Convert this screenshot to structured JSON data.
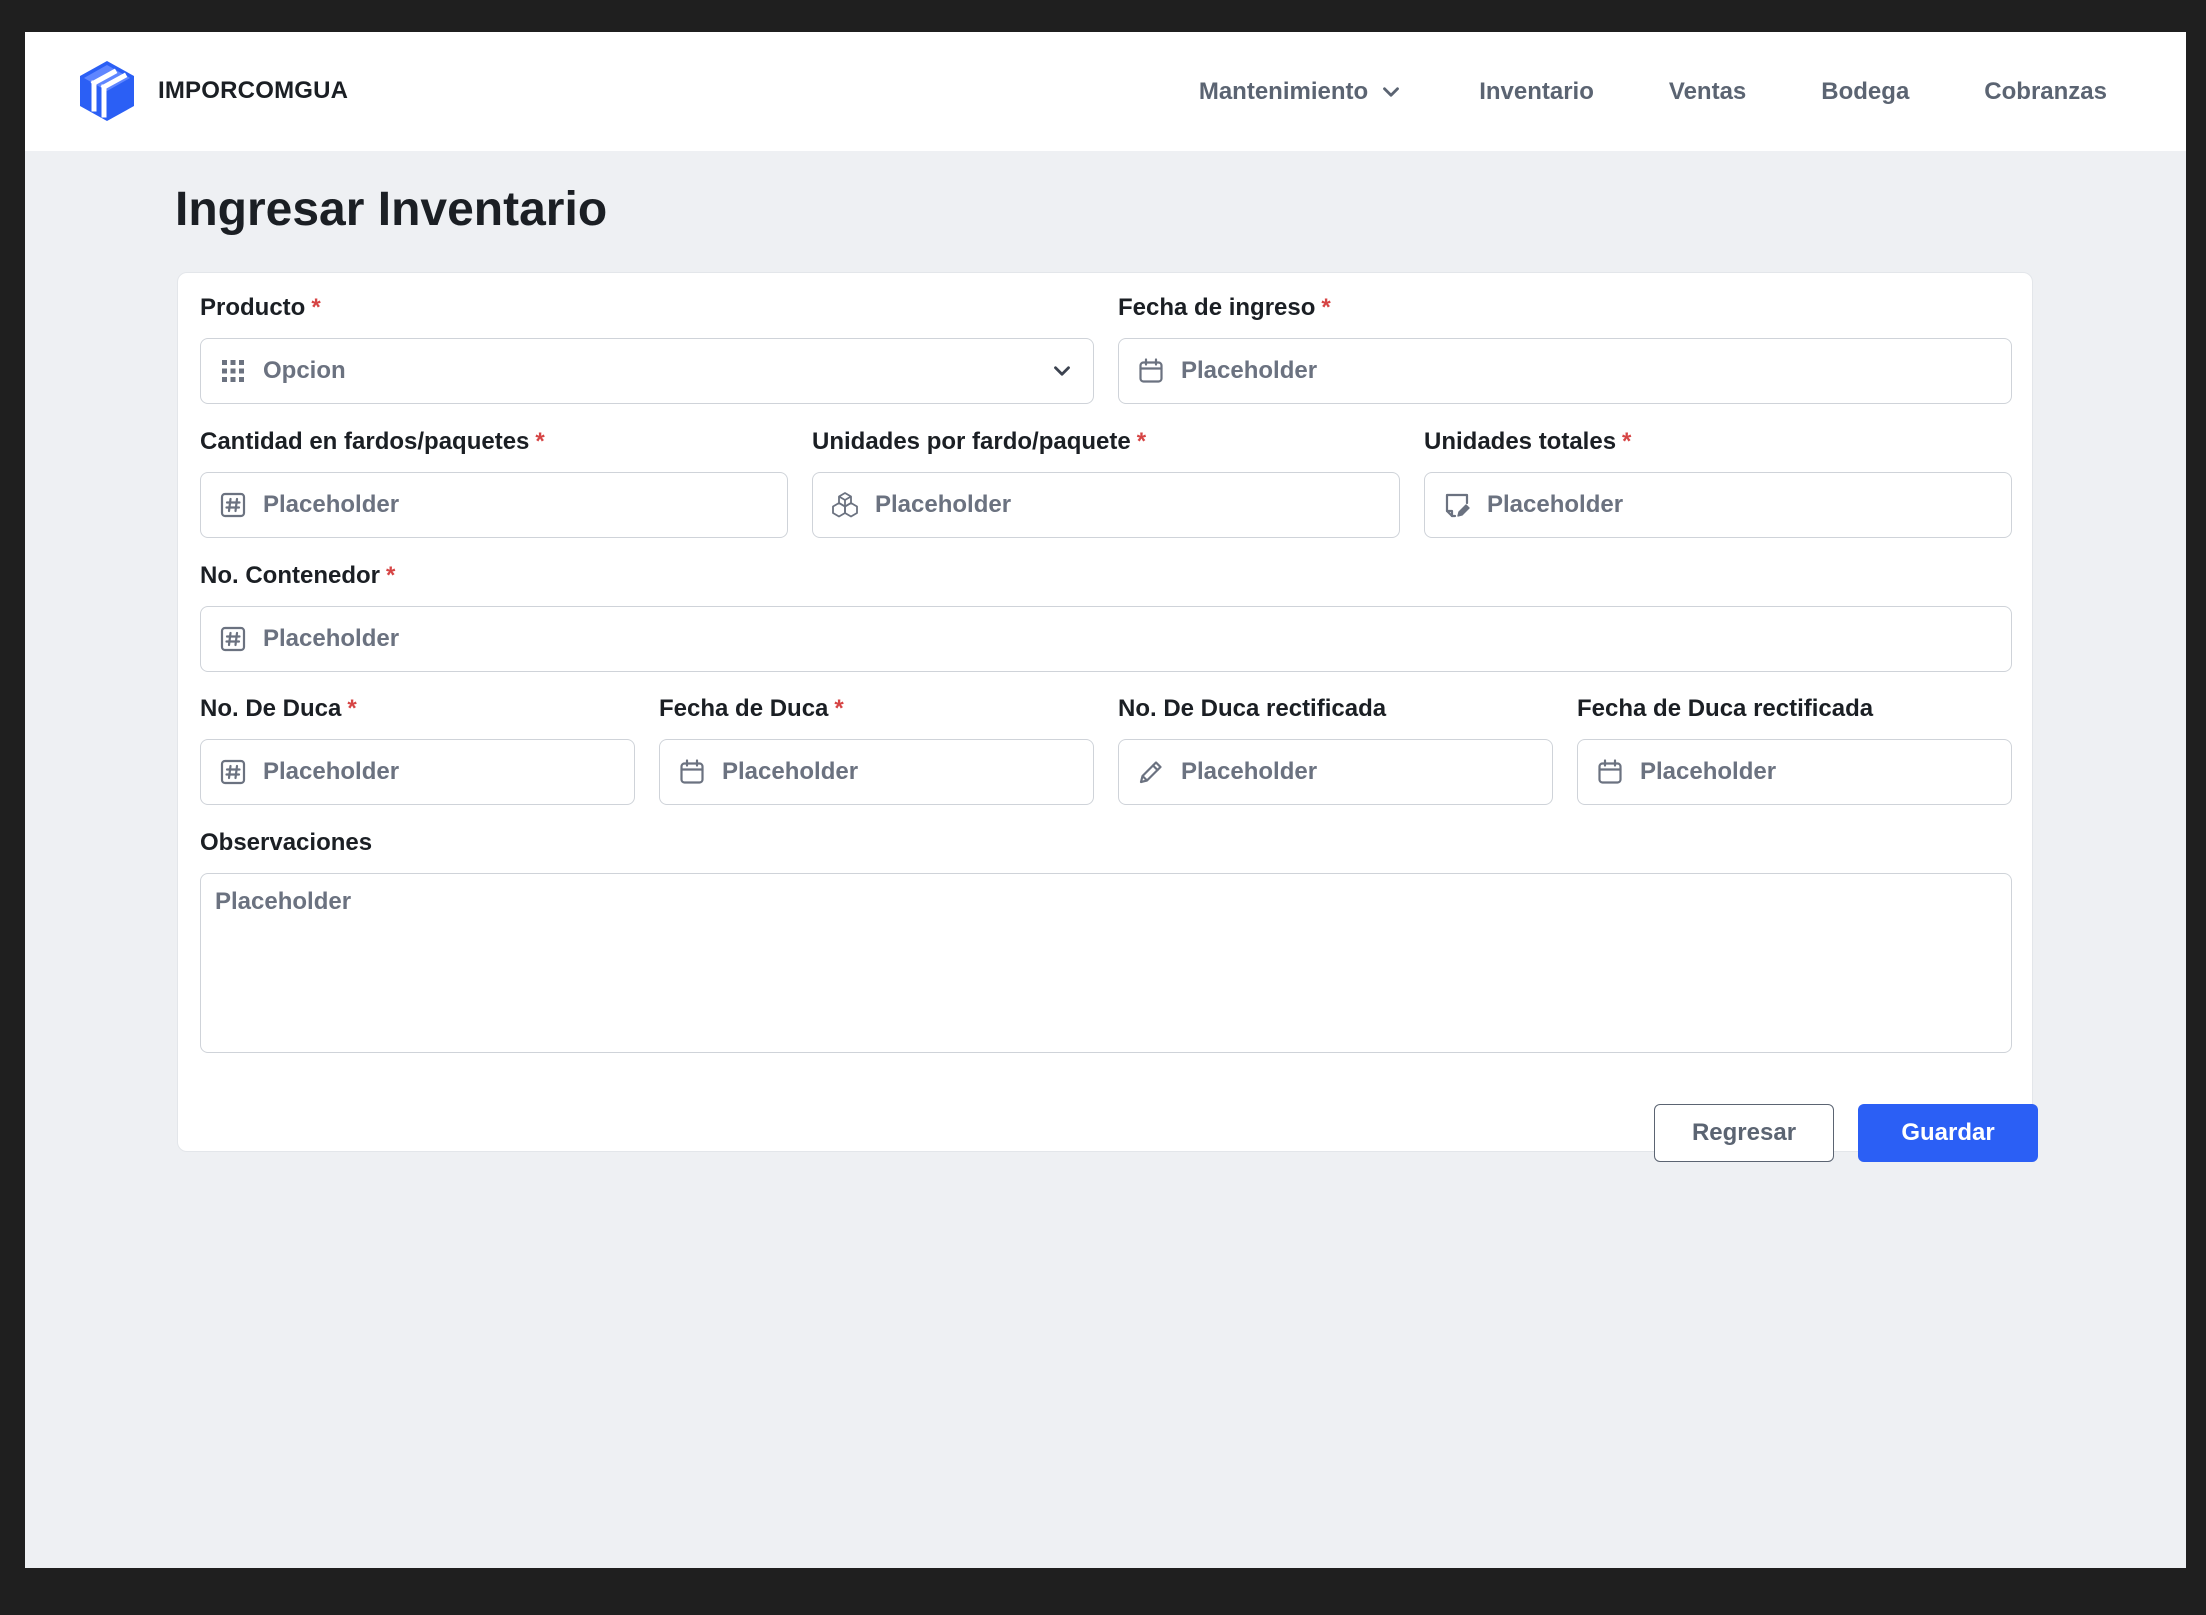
{
  "brand": {
    "name": "IMPORCOMGUA",
    "logo_icon": "box-cube-logo",
    "accent": "#2b5ff5"
  },
  "nav": {
    "items": [
      {
        "label": "Mantenimiento",
        "has_dropdown": true
      },
      {
        "label": "Inventario"
      },
      {
        "label": "Ventas"
      },
      {
        "label": "Bodega"
      },
      {
        "label": "Cobranzas"
      }
    ]
  },
  "page": {
    "title": "Ingresar Inventario"
  },
  "form": {
    "required_mark": "*",
    "producto": {
      "label": "Producto",
      "value": "Opcion",
      "icon": "grid-icon"
    },
    "fecha_ingreso": {
      "label": "Fecha de ingreso",
      "placeholder": "Placeholder",
      "icon": "calendar-icon"
    },
    "cantidad": {
      "label": "Cantidad en fardos/paquetes",
      "placeholder": "Placeholder",
      "icon": "hash-icon"
    },
    "unidades_fardo": {
      "label": "Unidades por fardo/paquete",
      "placeholder": "Placeholder",
      "icon": "boxes-icon"
    },
    "unidades_totales": {
      "label": "Unidades totales",
      "placeholder": "Placeholder",
      "icon": "note-edit-icon"
    },
    "contenedor": {
      "label": "No. Contenedor",
      "placeholder": "Placeholder",
      "icon": "hash-icon"
    },
    "duca": {
      "label": "No. De Duca",
      "placeholder": "Placeholder",
      "icon": "hash-icon"
    },
    "fecha_duca": {
      "label": "Fecha de Duca",
      "placeholder": "Placeholder",
      "icon": "calendar-icon"
    },
    "duca_rect": {
      "label": "No. De Duca rectificada",
      "placeholder": "Placeholder",
      "icon": "pencil-icon"
    },
    "fecha_duca_rect": {
      "label": "Fecha de Duca rectificada",
      "placeholder": "Placeholder",
      "icon": "calendar-icon"
    },
    "observaciones": {
      "label": "Observaciones",
      "placeholder": "Placeholder"
    },
    "buttons": {
      "back": "Regresar",
      "save": "Guardar"
    }
  }
}
